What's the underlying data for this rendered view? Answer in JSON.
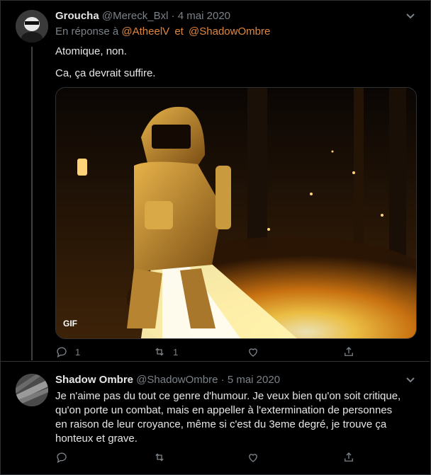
{
  "tweet1": {
    "name": "Groucha",
    "handle": "@Mereck_Bxl",
    "date": "· 4 mai 2020",
    "reply_prefix": "En réponse à",
    "mention1": "@AtheelV",
    "reply_sep": "et",
    "mention2": "@ShadowOmbre",
    "line1": "Atomique, non.",
    "line2": "Ca, ça devrait suffire.",
    "media_badge": "GIF",
    "reply_count": "1",
    "retweet_count": "1"
  },
  "tweet2": {
    "name": "Shadow Ombre",
    "handle": "@ShadowOmbre",
    "date": "· 5 mai 2020",
    "text_lines": [
      "Je n'aime pas du tout ce genre d'humour. Je veux bien qu'on soit critique,",
      "qu'on porte un combat, mais en appeller à l'extermination de personnes",
      "en raison de leur croyance, même si c'est du 3eme degré, je trouve ça",
      "honteux et grave."
    ]
  },
  "colors": {
    "mention": "#e0863b",
    "muted": "#7b8288",
    "text": "#e6e6e6",
    "background": "#000000"
  },
  "icons": [
    "reply-icon",
    "retweet-icon",
    "like-icon",
    "share-icon",
    "chevron-down-icon"
  ]
}
